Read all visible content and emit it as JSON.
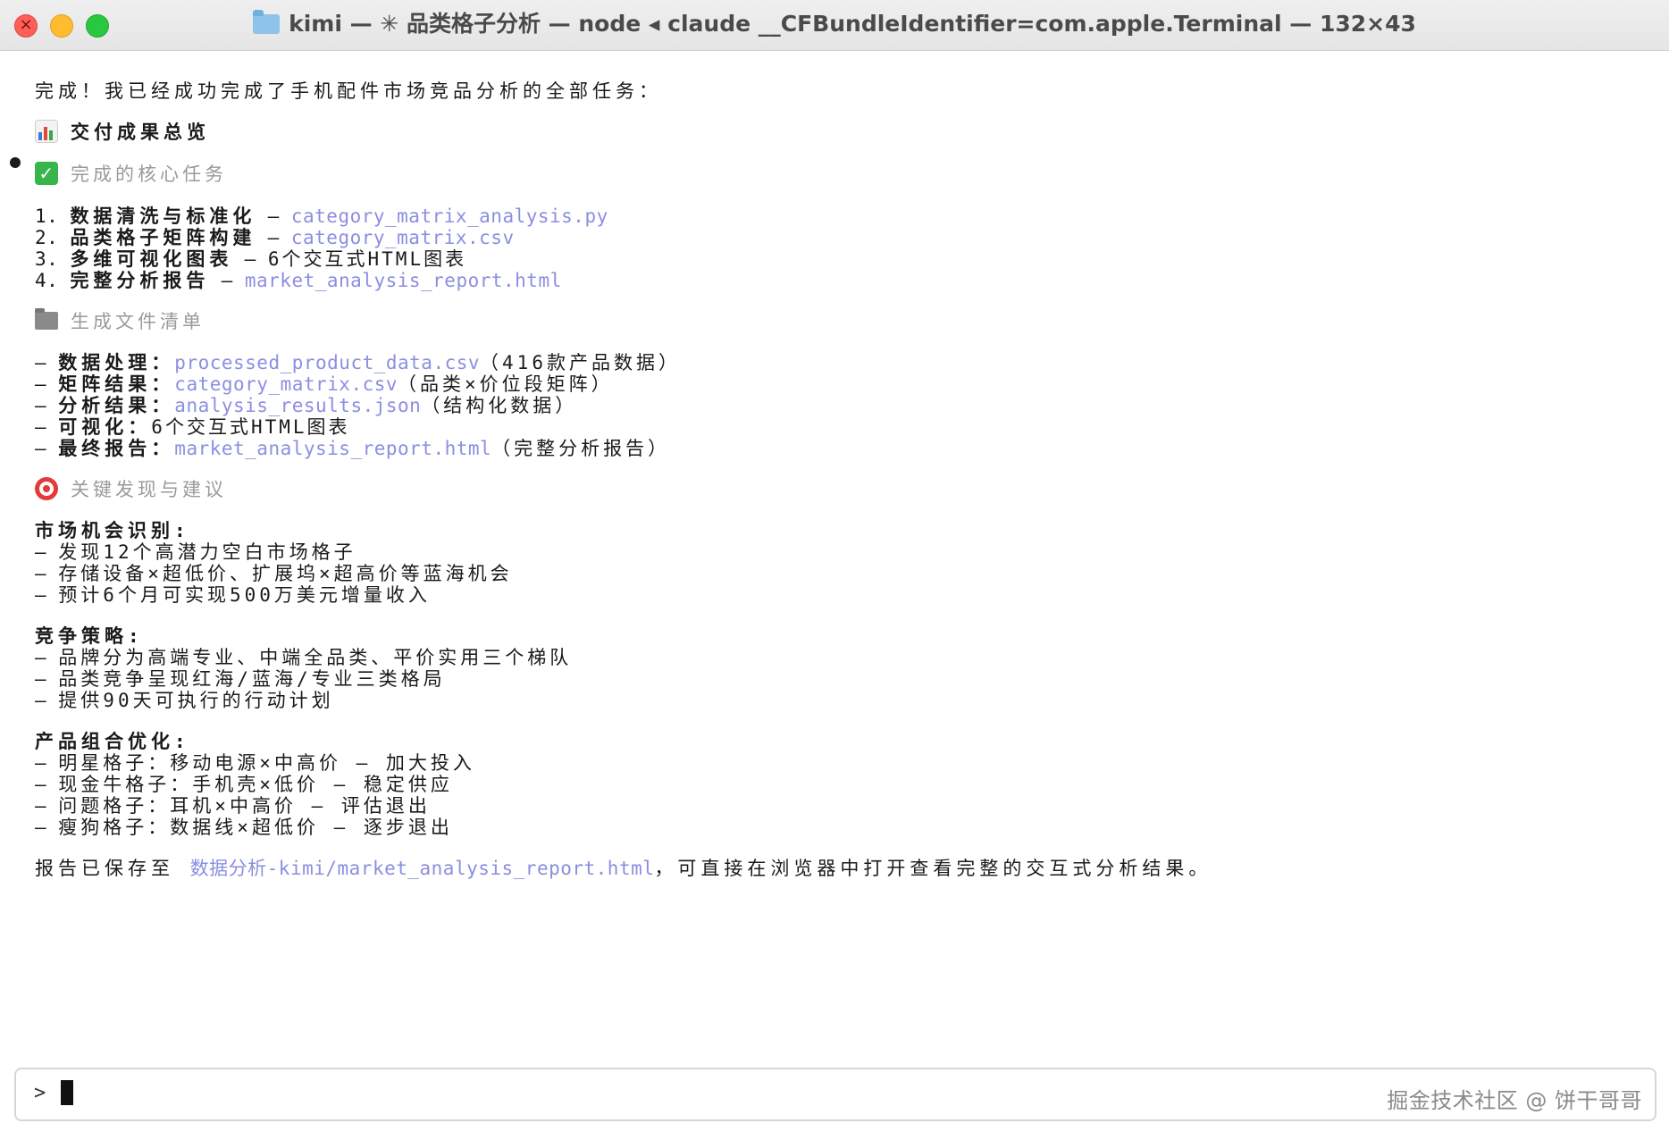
{
  "window": {
    "title": "kimi — ✳ 品类格子分析 — node ◂ claude __CFBundleIdentifier=com.apple.Terminal — 132×43"
  },
  "output": {
    "intro": "完成！我已经成功完成了手机配件市场竞品分析的全部任务：",
    "overview_heading": "交付成果总览",
    "core_tasks_heading": "完成的核心任务",
    "tasks": [
      {
        "num": "1. ",
        "title": "数据清洗与标准化",
        "sep": " – ",
        "detail": "category_matrix_analysis.py",
        "detail_is_link": true
      },
      {
        "num": "2. ",
        "title": "品类格子矩阵构建",
        "sep": " – ",
        "detail": "category_matrix.csv",
        "detail_is_link": true
      },
      {
        "num": "3. ",
        "title": "多维可视化图表",
        "sep": " – ",
        "detail": "6个交互式HTML图表",
        "detail_is_link": false
      },
      {
        "num": "4. ",
        "title": "完整分析报告",
        "sep": " – ",
        "detail": "market_analysis_report.html",
        "detail_is_link": true
      }
    ],
    "files_heading": "生成文件清单",
    "files": [
      {
        "label": "数据处理：",
        "value": "processed_product_data.csv",
        "note": "（416款产品数据）",
        "value_is_link": true
      },
      {
        "label": "矩阵结果：",
        "value": "category_matrix.csv",
        "note": "（品类×价位段矩阵）",
        "value_is_link": true
      },
      {
        "label": "分析结果：",
        "value": "analysis_results.json",
        "note": "（结构化数据）",
        "value_is_link": true
      },
      {
        "label": "可视化：",
        "value": "6个交互式HTML图表",
        "note": "",
        "value_is_link": false
      },
      {
        "label": "最终报告：",
        "value": "market_analysis_report.html",
        "note": "（完整分析报告）",
        "value_is_link": true
      }
    ],
    "findings_heading": "关键发现与建议",
    "sections": [
      {
        "title": "市场机会识别",
        "items": [
          "发现12个高潜力空白市场格子",
          "存储设备×超低价、扩展坞×超高价等蓝海机会",
          "预计6个月可实现500万美元增量收入"
        ]
      },
      {
        "title": "竞争策略",
        "items": [
          "品牌分为高端专业、中端全品类、平价实用三个梯队",
          "品类竞争呈现红海/蓝海/专业三类格局",
          "提供90天可执行的行动计划"
        ]
      },
      {
        "title": "产品组合优化",
        "items": [
          "明星格子：移动电源×中高价 – 加大投入",
          "现金牛格子：手机壳×低价 – 稳定供应",
          "问题格子：耳机×中高价 – 评估退出",
          "瘦狗格子：数据线×超低价 – 逐步退出"
        ]
      }
    ],
    "closing_prefix": "报告已保存至 ",
    "closing_path": "数据分析-kimi/market_analysis_report.html",
    "closing_suffix": "，可直接在浏览器中打开查看完整的交互式分析结果。"
  },
  "input": {
    "prompt": ">"
  },
  "watermark": "掘金技术社区 @ 饼干哥哥",
  "colors": {
    "link": "#8a8fe0",
    "dim_heading": "#9a9a9a",
    "text": "#1a1a1a",
    "close": "#fe5f57",
    "minimize": "#febc2e",
    "zoom": "#28c840"
  }
}
